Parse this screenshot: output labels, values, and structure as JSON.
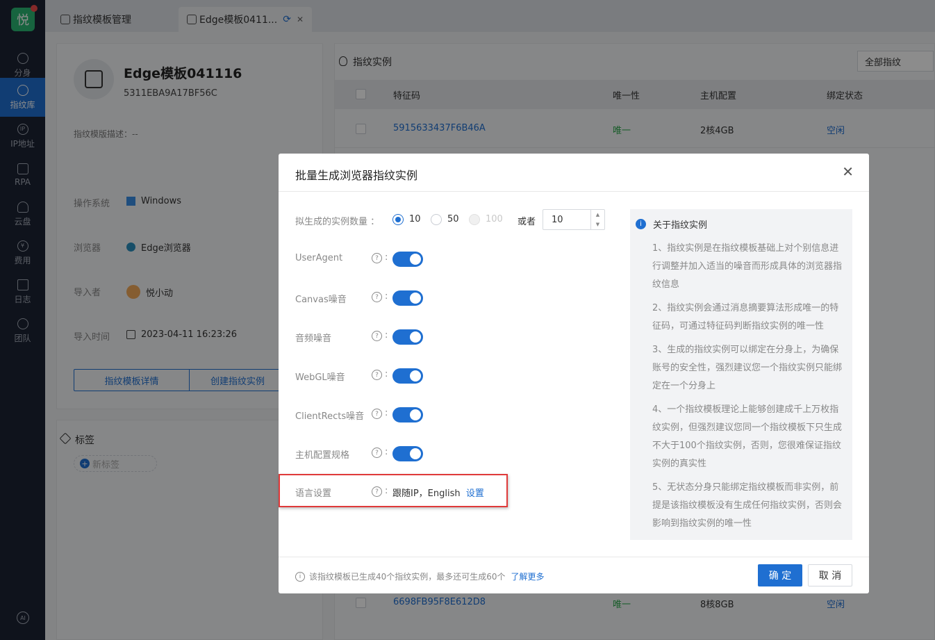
{
  "sidebar": {
    "logo": "悦",
    "items": [
      {
        "label": "分身",
        "icon": "chrome-icon"
      },
      {
        "label": "指纹库",
        "icon": "fingerprint-icon"
      },
      {
        "label": "IP地址",
        "icon": "ip-icon"
      },
      {
        "label": "RPA",
        "icon": "robot-icon"
      },
      {
        "label": "云盘",
        "icon": "cloud-drive-icon"
      },
      {
        "label": "费用",
        "icon": "yen-icon"
      },
      {
        "label": "日志",
        "icon": "document-icon"
      },
      {
        "label": "团队",
        "icon": "team-icon"
      }
    ],
    "active_index": 1,
    "ai_label": "AI"
  },
  "tabs": [
    {
      "label": "指纹模板管理"
    },
    {
      "label": "Edge模板0411..."
    }
  ],
  "template": {
    "name": "Edge模板041116",
    "code": "5311EBA9A17BF56C",
    "desc_label": "指纹模版描述：--",
    "os_label": "操作系统",
    "os_value": "Windows",
    "browser_label": "浏览器",
    "browser_value": "Edge浏览器",
    "importer_label": "导入者",
    "importer_value": "悦小动",
    "import_time_label": "导入时间",
    "import_time_value": "2023-04-11 16:23:26",
    "btn_details": "指纹模板详情",
    "btn_create": "创建指纹实例"
  },
  "tags": {
    "title": "标签",
    "new_tag": "新标签"
  },
  "instances": {
    "title": "指纹实例",
    "filter": "全部指纹",
    "columns": [
      "特征码",
      "唯一性",
      "主机配置",
      "绑定状态"
    ],
    "rows": [
      {
        "code": "5915633437F6B46A",
        "unique": "唯一",
        "config": "2核4GB",
        "status": "空闲"
      },
      {
        "code": "6698FB95F8E612D8",
        "unique": "唯一",
        "config": "8核8GB",
        "status": "空闲"
      }
    ]
  },
  "modal": {
    "title": "批量生成浏览器指纹实例",
    "close": "X",
    "count_label": "拟生成的实例数量",
    "options": [
      "10",
      "50",
      "100"
    ],
    "selected": "10",
    "or_label": "或者",
    "custom_value": "10",
    "settings": [
      {
        "label": "UserAgent",
        "on": true
      },
      {
        "label": "Canvas噪音",
        "on": true
      },
      {
        "label": "音频噪音",
        "on": true
      },
      {
        "label": "WebGL噪音",
        "on": true
      },
      {
        "label": "ClientRects噪音",
        "on": true
      },
      {
        "label": "主机配置规格",
        "on": true
      }
    ],
    "language_label": "语言设置",
    "language_value": "跟随IP，English",
    "language_action": "设置",
    "about": {
      "title": "关于指纹实例",
      "paragraphs": [
        "1、指纹实例是在指纹模板基础上对个别信息进行调整并加入适当的噪音而形成具体的浏览器指纹信息",
        "2、指纹实例会通过消息摘要算法形成唯一的特征码，可通过特征码判断指纹实例的唯一性",
        "3、生成的指纹实例可以绑定在分身上，为确保账号的安全性，强烈建议您一个指纹实例只能绑定在一个分身上",
        "4、一个指纹模板理论上能够创建成千上万枚指纹实例，但强烈建议您同一个指纹模板下只生成不大于100个指纹实例，否则，您很难保证指纹实例的真实性",
        "5、无状态分身只能绑定指纹模板而非实例，前提是该指纹模板没有生成任何指纹实例，否则会影响到指纹实例的唯一性"
      ]
    },
    "footer_note": "该指纹模板已生成40个指纹实例，最多还可生成60个",
    "learn_more": "了解更多",
    "ok": "确 定",
    "cancel": "取 消"
  },
  "colors": {
    "accent": "#1f6fd1",
    "sidebar": "#1c2333",
    "success": "#2aa84a",
    "highlight": "#e03a3a"
  }
}
